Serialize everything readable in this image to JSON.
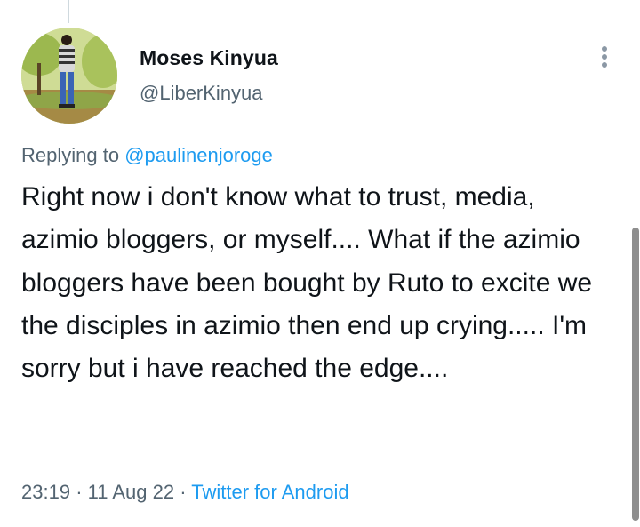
{
  "tweet": {
    "author": {
      "display_name": "Moses Kinyua",
      "handle": "@LiberKinyua"
    },
    "replying_prefix": "Replying to",
    "replying_to": "@paulinenjoroge",
    "text": "Right now i don't know what to trust, media, azimio bloggers, or myself.... What if the azimio bloggers have been bought by Ruto to excite we the disciples in azimio then end up crying..... I'm sorry but i have reached the edge....",
    "time": "23:19",
    "separator_1": "·",
    "date": "11 Aug 22",
    "separator_2": "·",
    "source": "Twitter for Android"
  },
  "colors": {
    "text_primary": "#0f1419",
    "text_secondary": "#536471",
    "link": "#1d9bf0",
    "scrollbar": "#8e8e8e"
  },
  "icons": {
    "more": "more-vertical-icon"
  }
}
